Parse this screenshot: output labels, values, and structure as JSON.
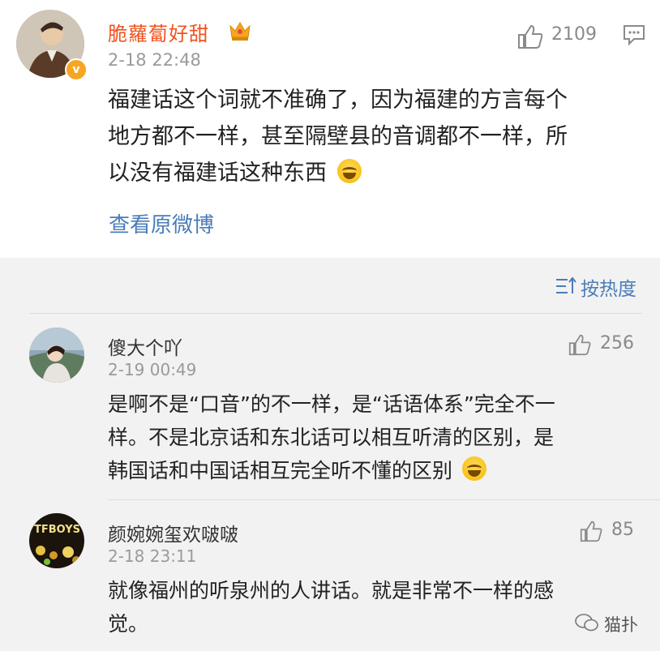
{
  "post": {
    "author": "脆蘿蔔好甜",
    "time": "2-18 22:48",
    "likes": "2109",
    "text_lines": [
      "福建话这个词就不准确了，因为福建的方言每个",
      "地方都不一样，甚至隔壁县的音调都不一样，所",
      "以没有福建话这种东西"
    ],
    "view_original": "查看原微博"
  },
  "sort": {
    "label": "按热度"
  },
  "comments": [
    {
      "author": "傻大个吖",
      "time": "2-19 00:49",
      "likes": "256",
      "text_lines": [
        "是啊不是“口音”的不一样，是“话语体系”完全不一",
        "样。不是北京话和东北话可以相互听清的区别，是",
        "韩国话和中国话相互完全听不懂的区别"
      ]
    },
    {
      "author": "颜婉婉玺欢啵啵",
      "time": "2-18 23:11",
      "likes": "85",
      "text_lines": [
        "就像福州的听泉州的人讲话。就是非常不一样的感",
        "觉。"
      ]
    }
  ],
  "watermark": "猫扑",
  "colors": {
    "author": "#f0531f",
    "link": "#4a7db8",
    "muted": "#9a9a9a",
    "comment_bg": "#f2f2f2"
  }
}
